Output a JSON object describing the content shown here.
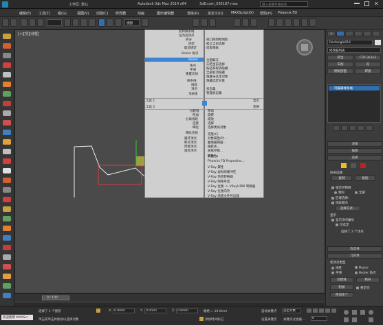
{
  "title": {
    "workspace": "工作区: 默认",
    "app": "Autodesk 3ds Max  2014 x64",
    "file": "3d8.com_595187.max",
    "search_placeholder": "键入关键字或短语"
  },
  "menu": [
    "编辑(E)",
    "工具(T)",
    "组(G)",
    "视图(V)",
    "创建(C)",
    "修改器",
    "动画",
    "图形编辑器",
    "渲染(R)",
    "自定义(U)",
    "MAXScript(X)",
    "帮助(H)",
    "Phoenix FD"
  ],
  "toolbar": {
    "view_select": "视图"
  },
  "viewport": {
    "label": "[+][顶][线框]"
  },
  "context_menu": {
    "col1": [
      "反转样条线",
      "设为首顶点",
      "拆分",
      "绑定",
      "取消绑定",
      "Bezier 角点",
      "Bezier",
      "角点",
      "平滑",
      "重置切线",
      "样条线",
      "线段",
      "顶点",
      "顶层级"
    ],
    "col1_header_a": "工具 1",
    "col1_header_b": "工具 2",
    "col2": [
      "视口照明和阴影",
      "孤立当前选择",
      "结束隔离",
      "全部解冻",
      "冻结当前选择",
      "按名称取消隐藏",
      "全部取消隐藏",
      "隐藏未选定对象",
      "隐藏选定对象",
      "状态集",
      "管理状态集"
    ],
    "col2_header_a": "显示",
    "col2_header_b": "变换",
    "col1_lower": [
      "创建线",
      "附加",
      "分离线段",
      "连接",
      "细化",
      "细化连接",
      "循环顶点",
      "断开顶点",
      "焊接顶点",
      "熔合顶点"
    ],
    "col2_lower": [
      "移动",
      "旋转",
      "缩放",
      "选择",
      "选择类似对象",
      "克隆(C)",
      "对象属性(P)...",
      "曲线编辑器...",
      "摄影表...",
      "关联参数...",
      "转换为:",
      "Phoenix FD Properties...",
      "V-Ray 属性",
      "V-Ray 虚拟帧缓冲区",
      "V-Ray 场景转换器",
      "V-Ray 网格导出",
      "V-Ray 位图 -> VRayHDRI 转换器",
      "V-Ray 位图向导",
      "V-Ray 场景文件导出器"
    ]
  },
  "right_panel": {
    "object_name": "Rectangle014",
    "modifier_list": "修改器列表",
    "btn_extrude": "挤出",
    "btn_ffd": "FFD 3x3x3",
    "btn_lathe": "车削",
    "btn_shell": "壳",
    "btn_bevel": "倒角剖面",
    "btn_weld": "焊接",
    "stack_item": "可编辑样条线",
    "rollout_render": "渲染",
    "rollout_interp": "插值",
    "rollout_select": "选择",
    "named_sel": "命名选择:",
    "copy": "复制",
    "paste": "粘贴",
    "lock_handles": "锁定控制柄",
    "similar": "相似",
    "all": "全部",
    "area_select": "区域选择:",
    "segment_end": "线段端点",
    "select_by": "选择方式...",
    "display": "显示",
    "show_vertex_numbers": "显示顶点编号",
    "selected_only": "仅选定",
    "selected_count": "选择了 2 个顶点",
    "soft_select": "软选择",
    "geometry": "几何体",
    "new_vertex_type": "新顶点类型",
    "linear": "线性",
    "bezier": "Bezier",
    "smooth": "平滑",
    "bezier_corner": "Bezier 角点",
    "create_line": "创建线",
    "break": "断开",
    "attach": "附加",
    "reorient": "重定向",
    "attach_mult": "附加多个"
  },
  "timeline": {
    "frame": "0 / 100"
  },
  "status": {
    "welcome": "欢迎使用 MAXScr",
    "selected": "选择了 1 个图形",
    "hint": "单击或单击并拖动以选择对象",
    "x_label": "X:",
    "x_val": "0.0mm",
    "y_label": "Y:",
    "y_val": "0.0mm",
    "z_label": "Z:",
    "z_val": "0.0mm",
    "grid": "栅格 = 10.0mm",
    "autokey": "自动关键点",
    "selected_obj": "选定对象",
    "set_key": "设置关键点",
    "key_filter": "关键点过滤器...",
    "add_time_tag": "添加时间标记",
    "frame_val": "0"
  }
}
